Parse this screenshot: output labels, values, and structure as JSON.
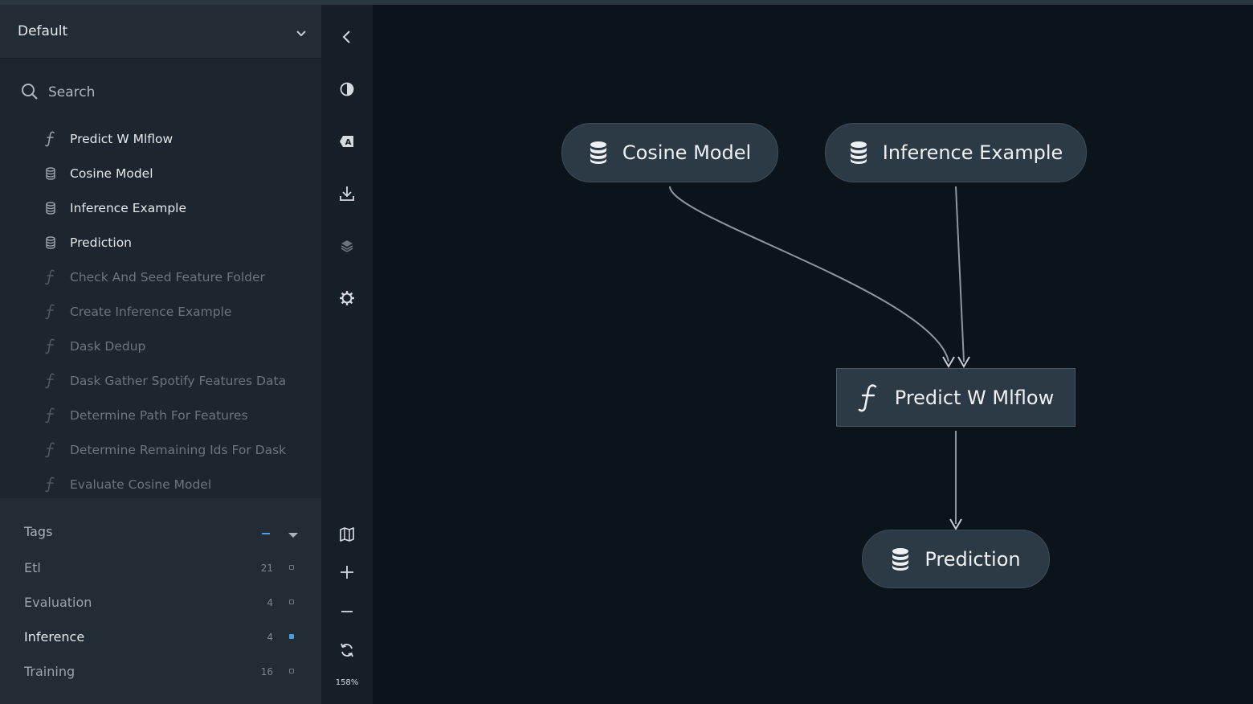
{
  "sidebar": {
    "pipeline_select": {
      "value": "Default"
    },
    "search": {
      "placeholder": "Search"
    },
    "nodes": [
      {
        "label": "Predict W Mlflow",
        "type": "function-icon",
        "state": "active"
      },
      {
        "label": "Cosine Model",
        "type": "dataset-icon",
        "state": "active"
      },
      {
        "label": "Inference Example",
        "type": "dataset-icon",
        "state": "active"
      },
      {
        "label": "Prediction",
        "type": "dataset-icon",
        "state": "active"
      },
      {
        "label": "Check And Seed Feature Folder",
        "type": "function-icon",
        "state": "dim"
      },
      {
        "label": "Create Inference Example",
        "type": "function-icon",
        "state": "dim"
      },
      {
        "label": "Dask Dedup",
        "type": "function-icon",
        "state": "dim"
      },
      {
        "label": "Dask Gather Spotify Features Data",
        "type": "function-icon",
        "state": "dim"
      },
      {
        "label": "Determine Path For Features",
        "type": "function-icon",
        "state": "dim"
      },
      {
        "label": "Determine Remaining Ids For Dask",
        "type": "function-icon",
        "state": "dim"
      },
      {
        "label": "Evaluate Cosine Model",
        "type": "function-icon",
        "state": "dim"
      }
    ],
    "tags": {
      "title": "Tags",
      "items": [
        {
          "name": "Etl",
          "count": "21",
          "selected": false
        },
        {
          "name": "Evaluation",
          "count": "4",
          "selected": false
        },
        {
          "name": "Inference",
          "count": "4",
          "selected": true
        },
        {
          "name": "Training",
          "count": "16",
          "selected": false
        }
      ]
    }
  },
  "toolbar": {
    "buttons": [
      "collapse-sidebar",
      "theme-toggle",
      "toggle-text-labels",
      "export",
      "layers",
      "settings",
      "minimap",
      "zoom-in",
      "zoom-out",
      "reset-view"
    ],
    "zoom_level": "158%"
  },
  "graph": {
    "nodes": {
      "cosine_model": "Cosine Model",
      "inference_example": "Inference Example",
      "predict_w_mlflow": "Predict W Mlflow",
      "prediction": "Prediction"
    }
  },
  "colors": {
    "background": "#0b141b",
    "sidebar": "#1d262e",
    "node": "#2c3a46",
    "accent": "#4a9fd8",
    "edge": "#8e979f"
  }
}
